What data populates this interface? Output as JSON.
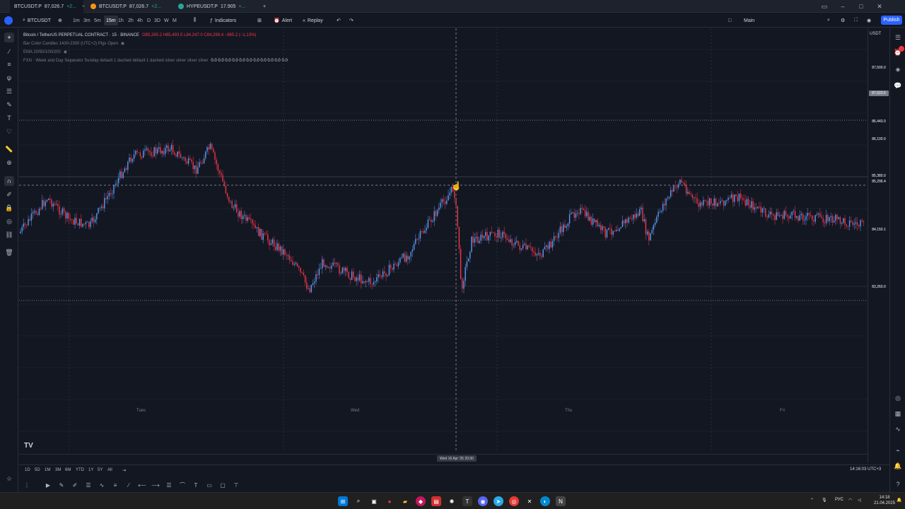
{
  "tabs": [
    {
      "symbol": "BTCUSDT.P",
      "price": "87,026.7",
      "change": "+2...",
      "active": true
    },
    {
      "symbol": "BTCUSDT.P",
      "price": "87,026.7",
      "change": "+2...",
      "active": false
    },
    {
      "symbol": "HYPEUSDT.P",
      "price": "17.905",
      "change": "+...",
      "active": false
    }
  ],
  "toolbar": {
    "symbol_search": "BTCUSDT",
    "timeframes": [
      "1m",
      "3m",
      "5m",
      "15m",
      "1h",
      "2h",
      "4h",
      "D",
      "3D",
      "W",
      "M"
    ],
    "active_timeframe": "15m",
    "indicators_label": "Indicators",
    "alert_label": "Alert",
    "replay_label": "Replay",
    "layout_name": "Main",
    "publish_label": "Publish"
  },
  "legend": {
    "title": "Bitcoin / TetherUS PERPETUAL CONTRACT · 15 · BINANCE",
    "ohlc": "O85,265.2 H85,493.5 L84,247.0 C84,299.4 −965.2 (−1.13%)",
    "indicator1": "Bar Color Candles 1430-2300 (UTC+2) Pigs Open",
    "indicator2": "EMA 20/50/100/200",
    "indicator3": "FXN · Week and Day Separator Sunday default 1 dashed default 1 dashed silver silver silver silver",
    "indicator3_values": "0.0 0.0 0.0 0.0 0.0 0.0 0.0 0.0 0.0 0.0 0.0"
  },
  "price_scale": {
    "currency": "USDT",
    "tags": [
      {
        "label": "87,500.0",
        "color": "#363a45"
      },
      {
        "label": "87,023.5",
        "color": "#787b86"
      },
      {
        "label": "86,443.0",
        "color": "#363a45"
      },
      {
        "label": "86,100.0",
        "color": "#363a45"
      },
      {
        "label": "85,380.0",
        "color": "#363a45"
      },
      {
        "label": "85,296.4",
        "color": "#363a45"
      },
      {
        "label": "84,150.1",
        "color": "#363a45"
      },
      {
        "label": "83,260.0",
        "color": "#363a45"
      }
    ]
  },
  "days": [
    "Tues",
    "Wed",
    "Thu",
    "Fri"
  ],
  "crosshair_time": "Wed 16 Apr '25  20:30",
  "ranges": [
    "1D",
    "5D",
    "1M",
    "3M",
    "6M",
    "YTD",
    "1Y",
    "5Y",
    "All"
  ],
  "clock": "14:16:03 UTC+3",
  "brand": "TV",
  "taskbar": {
    "lang": "РУС",
    "time": "14:18",
    "date": "21.04.2025"
  },
  "colors": {
    "up": "#5b9cf6",
    "down": "#f23645",
    "accent": "#2962ff"
  }
}
